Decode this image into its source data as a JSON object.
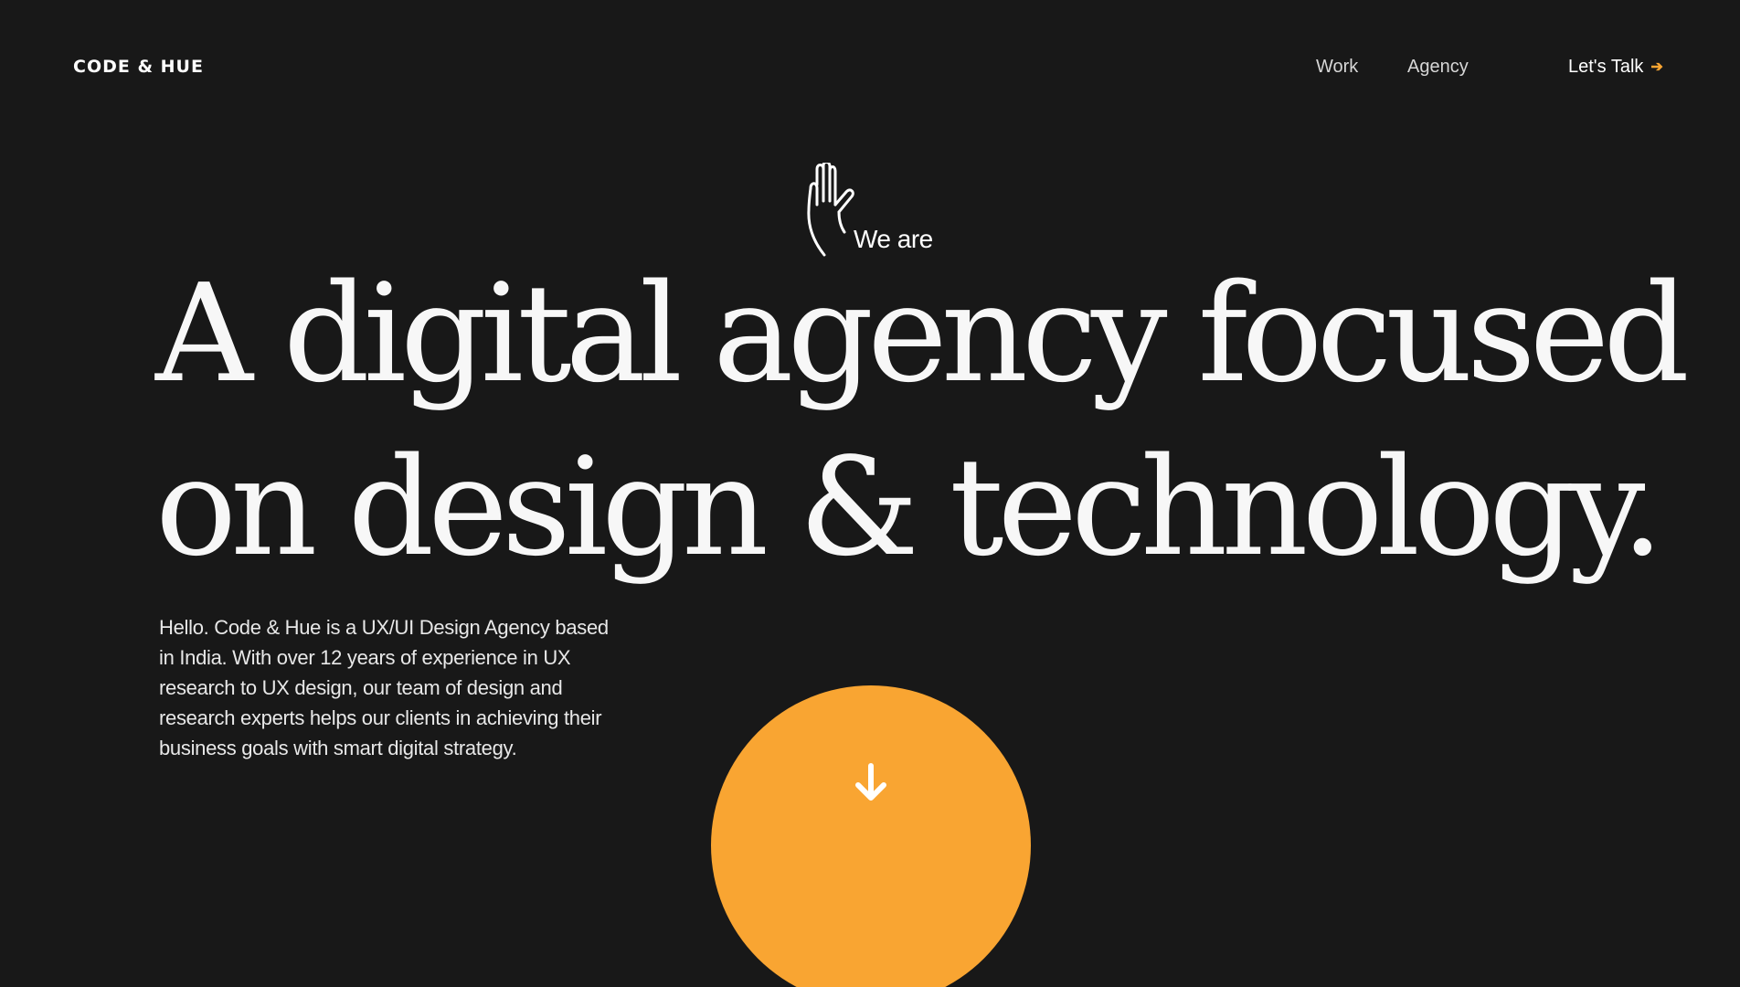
{
  "header": {
    "logo": "CODE & HUE",
    "nav": {
      "work": "Work",
      "agency": "Agency",
      "cta": "Let's Talk",
      "cta_icon": "arrow-right-icon"
    }
  },
  "hero": {
    "greeting_icon": "waving-hand-icon",
    "greeting": "We are",
    "headline_line1": "A digital agency focused",
    "headline_line2": "on design & technology.",
    "intro": "Hello. Code & Hue is a UX/UI Design Agency based in India. With over 12 years of experience in UX research to UX design, our team of design and research experts helps our clients in achieving their business goals with smart digital strategy.",
    "scroll_icon": "arrow-down-icon"
  },
  "colors": {
    "background": "#181818",
    "accent": "#f9a532",
    "text": "#f5f5f5"
  }
}
